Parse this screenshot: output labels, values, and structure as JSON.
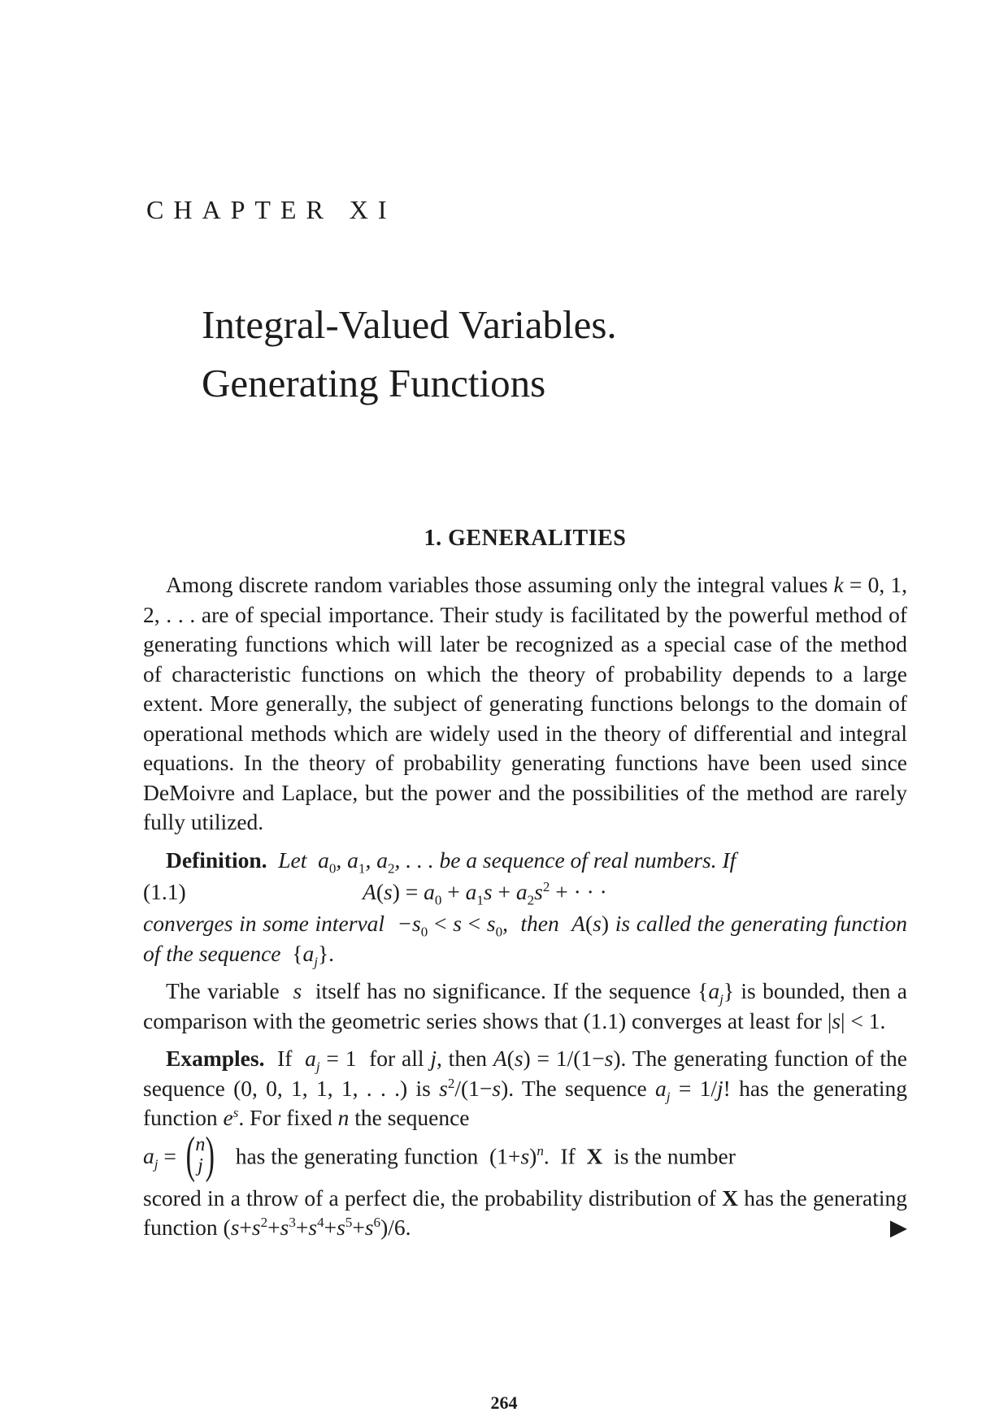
{
  "chapter": {
    "label": "CHAPTER XI",
    "title_line1": "Integral-Valued Variables.",
    "title_line2": "Generating Functions"
  },
  "section_heading": "1. GENERALITIES",
  "page_number": "264"
}
